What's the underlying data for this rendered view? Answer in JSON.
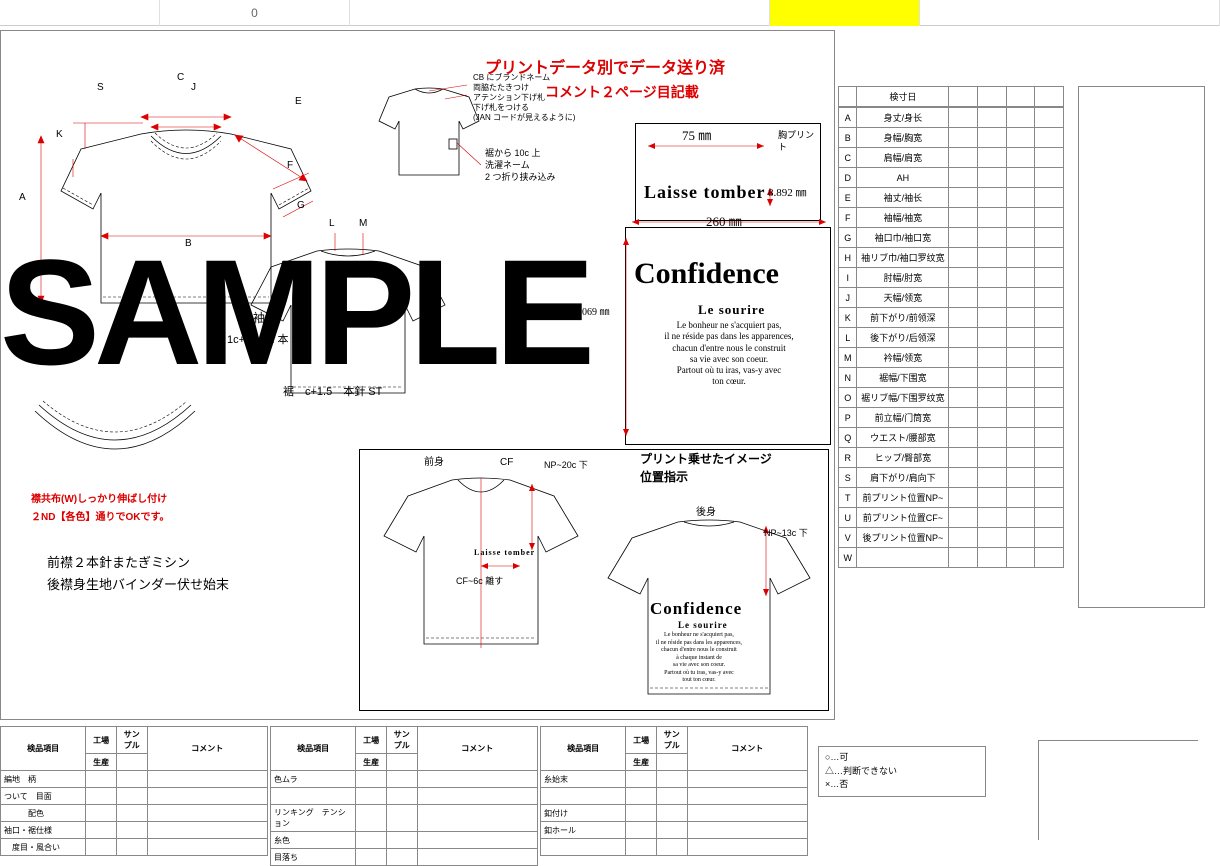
{
  "topbar": {
    "cellB": "0"
  },
  "header": {
    "line1": "プリントデータ別でデータ送り済",
    "line2": "コメント２ページ目記載"
  },
  "drawing": {
    "letters": [
      "S",
      "C",
      "J",
      "E",
      "K",
      "F",
      "G",
      "A",
      "B",
      "L",
      "M"
    ],
    "notes_right_top": [
      "CB にブランドネーム",
      "両脇たたきつけ",
      "アテンション下げ札",
      "下げ札をつける",
      "(JAN コードが見えるように)"
    ],
    "notes_right_mid": [
      "裾から 10c 上",
      "洗濯ネーム",
      "2 つ折り挟み込み"
    ],
    "sleeve_label": "袖口",
    "sleeve_note": "1c+1 ／ 2 本 ST",
    "hem_note": "裾　c+1.5　本針 ST",
    "collar_note1": "襟共布(W)しっかり伸ばし付け",
    "collar_note2": "２ND【各色】通りでOKです。",
    "sewing_note1": "前襟２本針またぎミシン",
    "sewing_note2": "後襟身生地バインダー伏せ始末"
  },
  "print_box": {
    "width_label": "75 ㎜",
    "height_label": "8.892 ㎜",
    "chest_label": "胸プリント",
    "text": "Laisse tomber",
    "back_width": "260 ㎜",
    "back_sub_label": "069 ㎜",
    "back_title": "Confidence",
    "back_sub": "Le sourire",
    "back_body": [
      "Le bonheur ne s'acquiert pas,",
      "il ne réside pas dans les apparences,",
      "chacun d'entre nous le construit",
      "sa vie avec son coeur.",
      "",
      "Partout où tu iras, vas-y avec",
      "ton cœur."
    ]
  },
  "layout_panel": {
    "title_top": "プリント乗せたイメージ",
    "title_sub": "位置指示",
    "front_label": "前身",
    "back_label": "後身",
    "cf_label": "CF",
    "np_front": "NP~20c 下",
    "cf_off": "CF~6c 離す",
    "np_back": "NP~13c 下",
    "front_print": "Laisse tomber",
    "back_title": "Confidence",
    "back_sub": "Le sourire",
    "back_body": [
      "Le bonheur ne s'acquiert pas,",
      "il ne réside pas dans les apparences,",
      "chacun d'entre nous le construit",
      "à chaque instant de",
      "sa vie avec son coeur.",
      "Partout où tu iras, vas-y avec",
      "tout ton cœur."
    ]
  },
  "spec_table": {
    "head": "検寸日",
    "rows": [
      {
        "k": "A",
        "l": "身丈/身长"
      },
      {
        "k": "B",
        "l": "身幅/胸宽"
      },
      {
        "k": "C",
        "l": "肩幅/肩宽"
      },
      {
        "k": "D",
        "l": "AH"
      },
      {
        "k": "E",
        "l": "袖丈/袖长"
      },
      {
        "k": "F",
        "l": "袖幅/袖宽"
      },
      {
        "k": "G",
        "l": "袖口巾/袖口宽"
      },
      {
        "k": "H",
        "l": "袖リブ巾/袖口罗纹宽"
      },
      {
        "k": "I",
        "l": "肘幅/肘宽"
      },
      {
        "k": "J",
        "l": "天幅/领宽"
      },
      {
        "k": "K",
        "l": "前下がり/前领深"
      },
      {
        "k": "L",
        "l": "後下がり/后领深"
      },
      {
        "k": "M",
        "l": "衿幅/领宽"
      },
      {
        "k": "N",
        "l": "裾幅/下围宽"
      },
      {
        "k": "O",
        "l": "裾リブ幅/下围罗纹宽"
      },
      {
        "k": "P",
        "l": "前立幅/门筒宽"
      },
      {
        "k": "Q",
        "l": "ウエスト/腰部宽"
      },
      {
        "k": "R",
        "l": "ヒップ/臀部宽"
      },
      {
        "k": "S",
        "l": "肩下がり/肩向下"
      },
      {
        "k": "T",
        "l": "前プリント位置NP~"
      },
      {
        "k": "U",
        "l": "前プリント位置CF~"
      },
      {
        "k": "V",
        "l": "後プリント位置NP~"
      },
      {
        "k": "W",
        "l": ""
      }
    ]
  },
  "qc_tables": {
    "header": [
      "検品項目",
      "工場",
      "生産",
      "サンプル",
      "コメント"
    ],
    "t1": [
      [
        "編地　柄",
        "",
        "",
        "",
        ""
      ],
      [
        "ついて　目面",
        "",
        "",
        "",
        ""
      ],
      [
        "　　　配色",
        "",
        "",
        "",
        ""
      ],
      [
        "袖口・裾仕様",
        "",
        "",
        "",
        ""
      ],
      [
        "　度目・風合い",
        "",
        "",
        "",
        ""
      ]
    ],
    "t2": [
      [
        "色ムラ",
        "",
        "",
        "",
        ""
      ],
      [
        "",
        "",
        "",
        "",
        ""
      ],
      [
        "リンキング　テンション",
        "",
        "",
        "",
        ""
      ],
      [
        "糸色",
        "",
        "",
        "",
        ""
      ],
      [
        "目落ち",
        "",
        "",
        "",
        ""
      ]
    ],
    "t3": [
      [
        "糸始末",
        "",
        "",
        "",
        ""
      ],
      [
        "",
        "",
        "",
        "",
        ""
      ],
      [
        "釦付け",
        "",
        "",
        "",
        ""
      ],
      [
        "釦ホール",
        "",
        "",
        "",
        ""
      ],
      [
        "",
        "",
        "",
        "",
        ""
      ]
    ],
    "legend": [
      "○…可",
      "△…判断できない",
      "×…否"
    ]
  },
  "watermark": "SAMPLE"
}
